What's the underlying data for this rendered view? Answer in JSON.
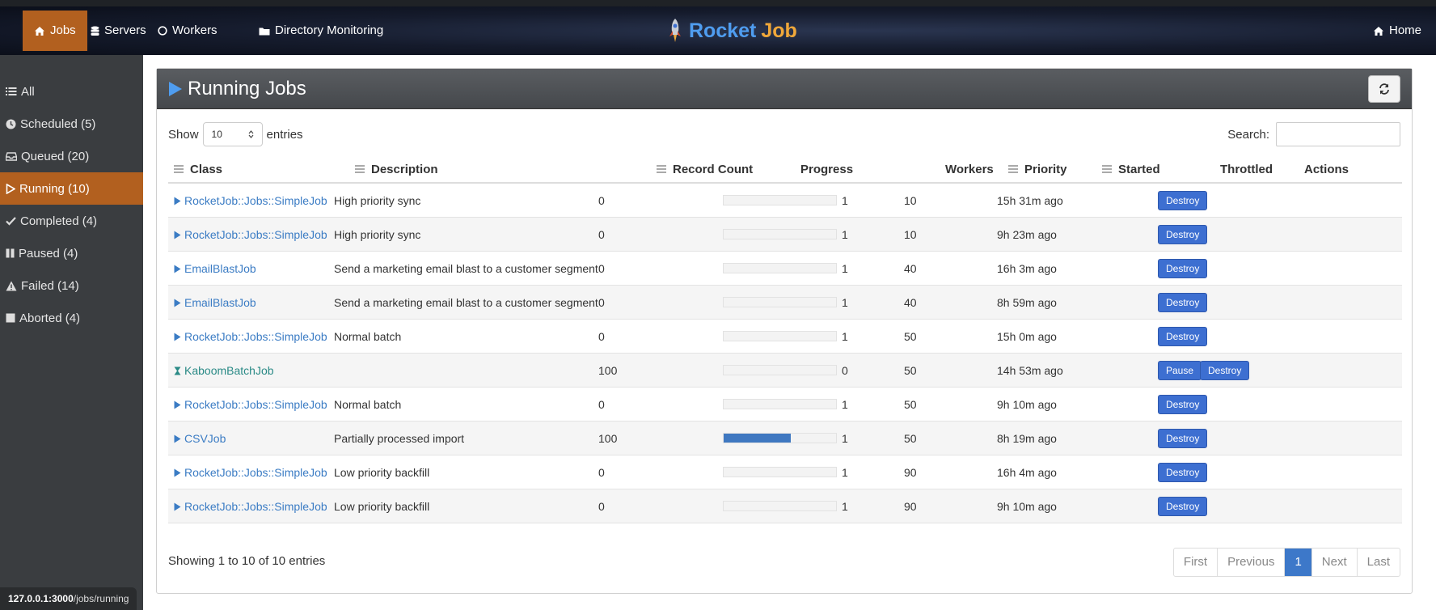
{
  "nav": {
    "items": [
      {
        "label": "Jobs",
        "icon": "home-icon"
      },
      {
        "label": "Servers",
        "icon": "database-icon"
      },
      {
        "label": "Workers",
        "icon": "circle-icon"
      },
      {
        "label": "Directory Monitoring",
        "icon": "folder-icon"
      }
    ],
    "brand_part1": "Rocket",
    "brand_part2": "Job",
    "home_label": "Home"
  },
  "sidebar": {
    "items": [
      {
        "label": "All",
        "icon": "list-icon"
      },
      {
        "label": "Scheduled (5)",
        "icon": "clock-icon"
      },
      {
        "label": "Queued (20)",
        "icon": "inbox-icon"
      },
      {
        "label": "Running (10)",
        "icon": "play-icon"
      },
      {
        "label": "Completed (4)",
        "icon": "check-icon"
      },
      {
        "label": "Paused (4)",
        "icon": "pause-icon"
      },
      {
        "label": "Failed (14)",
        "icon": "warning-icon"
      },
      {
        "label": "Aborted (4)",
        "icon": "stop-icon"
      }
    ],
    "status_url_host": "127.0.0.1:3000",
    "status_url_path": "/jobs/running"
  },
  "panel": {
    "title": "Running Jobs",
    "show_label": "Show",
    "entries_label": "entries",
    "page_length": "10",
    "search_label": "Search:",
    "search_value": ""
  },
  "table": {
    "headers": {
      "class": "Class",
      "description": "Description",
      "record_count": "Record Count",
      "progress": "Progress",
      "workers": "Workers",
      "priority": "Priority",
      "started": "Started",
      "throttled": "Throttled",
      "actions": "Actions"
    },
    "rows": [
      {
        "class": "RocketJob::Jobs::SimpleJob",
        "state": "running",
        "description": "High priority sync",
        "record_count": "0",
        "progress": 0,
        "workers": "1",
        "priority": "10",
        "started": "15h 31m ago",
        "throttled": "",
        "actions": [
          "Destroy"
        ]
      },
      {
        "class": "RocketJob::Jobs::SimpleJob",
        "state": "running",
        "description": "High priority sync",
        "record_count": "0",
        "progress": 0,
        "workers": "1",
        "priority": "10",
        "started": "9h 23m ago",
        "throttled": "",
        "actions": [
          "Destroy"
        ]
      },
      {
        "class": "EmailBlastJob",
        "state": "running",
        "description": "Send a marketing email blast to a customer segment",
        "record_count": "0",
        "progress": 0,
        "workers": "1",
        "priority": "40",
        "started": "16h 3m ago",
        "throttled": "",
        "actions": [
          "Destroy"
        ]
      },
      {
        "class": "EmailBlastJob",
        "state": "running",
        "description": "Send a marketing email blast to a customer segment",
        "record_count": "0",
        "progress": 0,
        "workers": "1",
        "priority": "40",
        "started": "8h 59m ago",
        "throttled": "",
        "actions": [
          "Destroy"
        ]
      },
      {
        "class": "RocketJob::Jobs::SimpleJob",
        "state": "running",
        "description": "Normal batch",
        "record_count": "0",
        "progress": 0,
        "workers": "1",
        "priority": "50",
        "started": "15h 0m ago",
        "throttled": "",
        "actions": [
          "Destroy"
        ]
      },
      {
        "class": "KaboomBatchJob",
        "state": "waiting",
        "description": "",
        "record_count": "100",
        "progress": 0,
        "workers": "0",
        "priority": "50",
        "started": "14h 53m ago",
        "throttled": "",
        "actions": [
          "Pause",
          "Destroy"
        ]
      },
      {
        "class": "RocketJob::Jobs::SimpleJob",
        "state": "running",
        "description": "Normal batch",
        "record_count": "0",
        "progress": 0,
        "workers": "1",
        "priority": "50",
        "started": "9h 10m ago",
        "throttled": "",
        "actions": [
          "Destroy"
        ]
      },
      {
        "class": "CSVJob",
        "state": "running",
        "description": "Partially processed import",
        "record_count": "100",
        "progress": 60,
        "workers": "1",
        "priority": "50",
        "started": "8h 19m ago",
        "throttled": "",
        "actions": [
          "Destroy"
        ]
      },
      {
        "class": "RocketJob::Jobs::SimpleJob",
        "state": "running",
        "description": "Low priority backfill",
        "record_count": "0",
        "progress": 0,
        "workers": "1",
        "priority": "90",
        "started": "16h 4m ago",
        "throttled": "",
        "actions": [
          "Destroy"
        ]
      },
      {
        "class": "RocketJob::Jobs::SimpleJob",
        "state": "running",
        "description": "Low priority backfill",
        "record_count": "0",
        "progress": 0,
        "workers": "1",
        "priority": "90",
        "started": "9h 10m ago",
        "throttled": "",
        "actions": [
          "Destroy"
        ]
      }
    ]
  },
  "footer": {
    "info": "Showing 1 to 10 of 10 entries",
    "pager": [
      "First",
      "Previous",
      "1",
      "Next",
      "Last"
    ],
    "current_page": "1"
  },
  "colors": {
    "accent": "#b2601f",
    "link": "#3b7cc4",
    "button": "#3d6fd1",
    "progress_fill": "#3f78c1"
  }
}
